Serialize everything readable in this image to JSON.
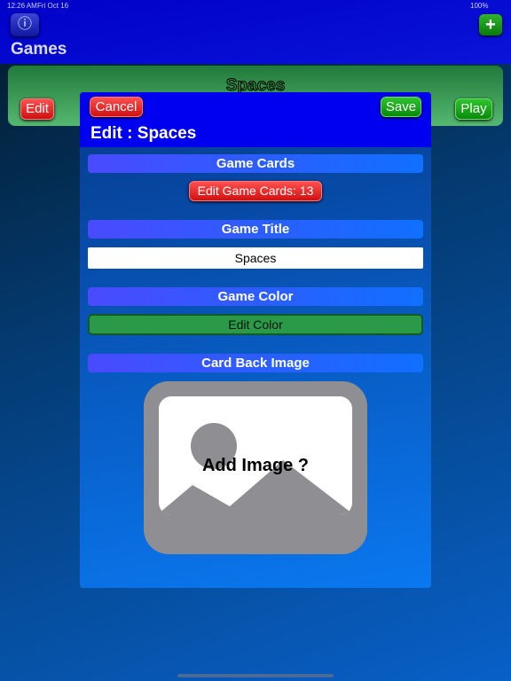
{
  "status": {
    "time": "12:26 AM",
    "date": "Fri Oct 16",
    "battery": "100%"
  },
  "header": {
    "title": "Games",
    "info_icon": "info-icon",
    "add_icon": "plus-icon"
  },
  "card": {
    "title": "Spaces",
    "edit_label": "Edit",
    "play_label": "Play",
    "color": "#2e8b4a"
  },
  "modal": {
    "cancel_label": "Cancel",
    "save_label": "Save",
    "title": "Edit : Spaces",
    "sections": {
      "cards": "Game Cards",
      "title": "Game Title",
      "color": "Game Color",
      "image": "Card Back Image"
    },
    "edit_cards_label": "Edit Game Cards: 13",
    "title_value": "Spaces",
    "edit_color_label": "Edit Color",
    "add_image_label": "Add Image ?"
  }
}
